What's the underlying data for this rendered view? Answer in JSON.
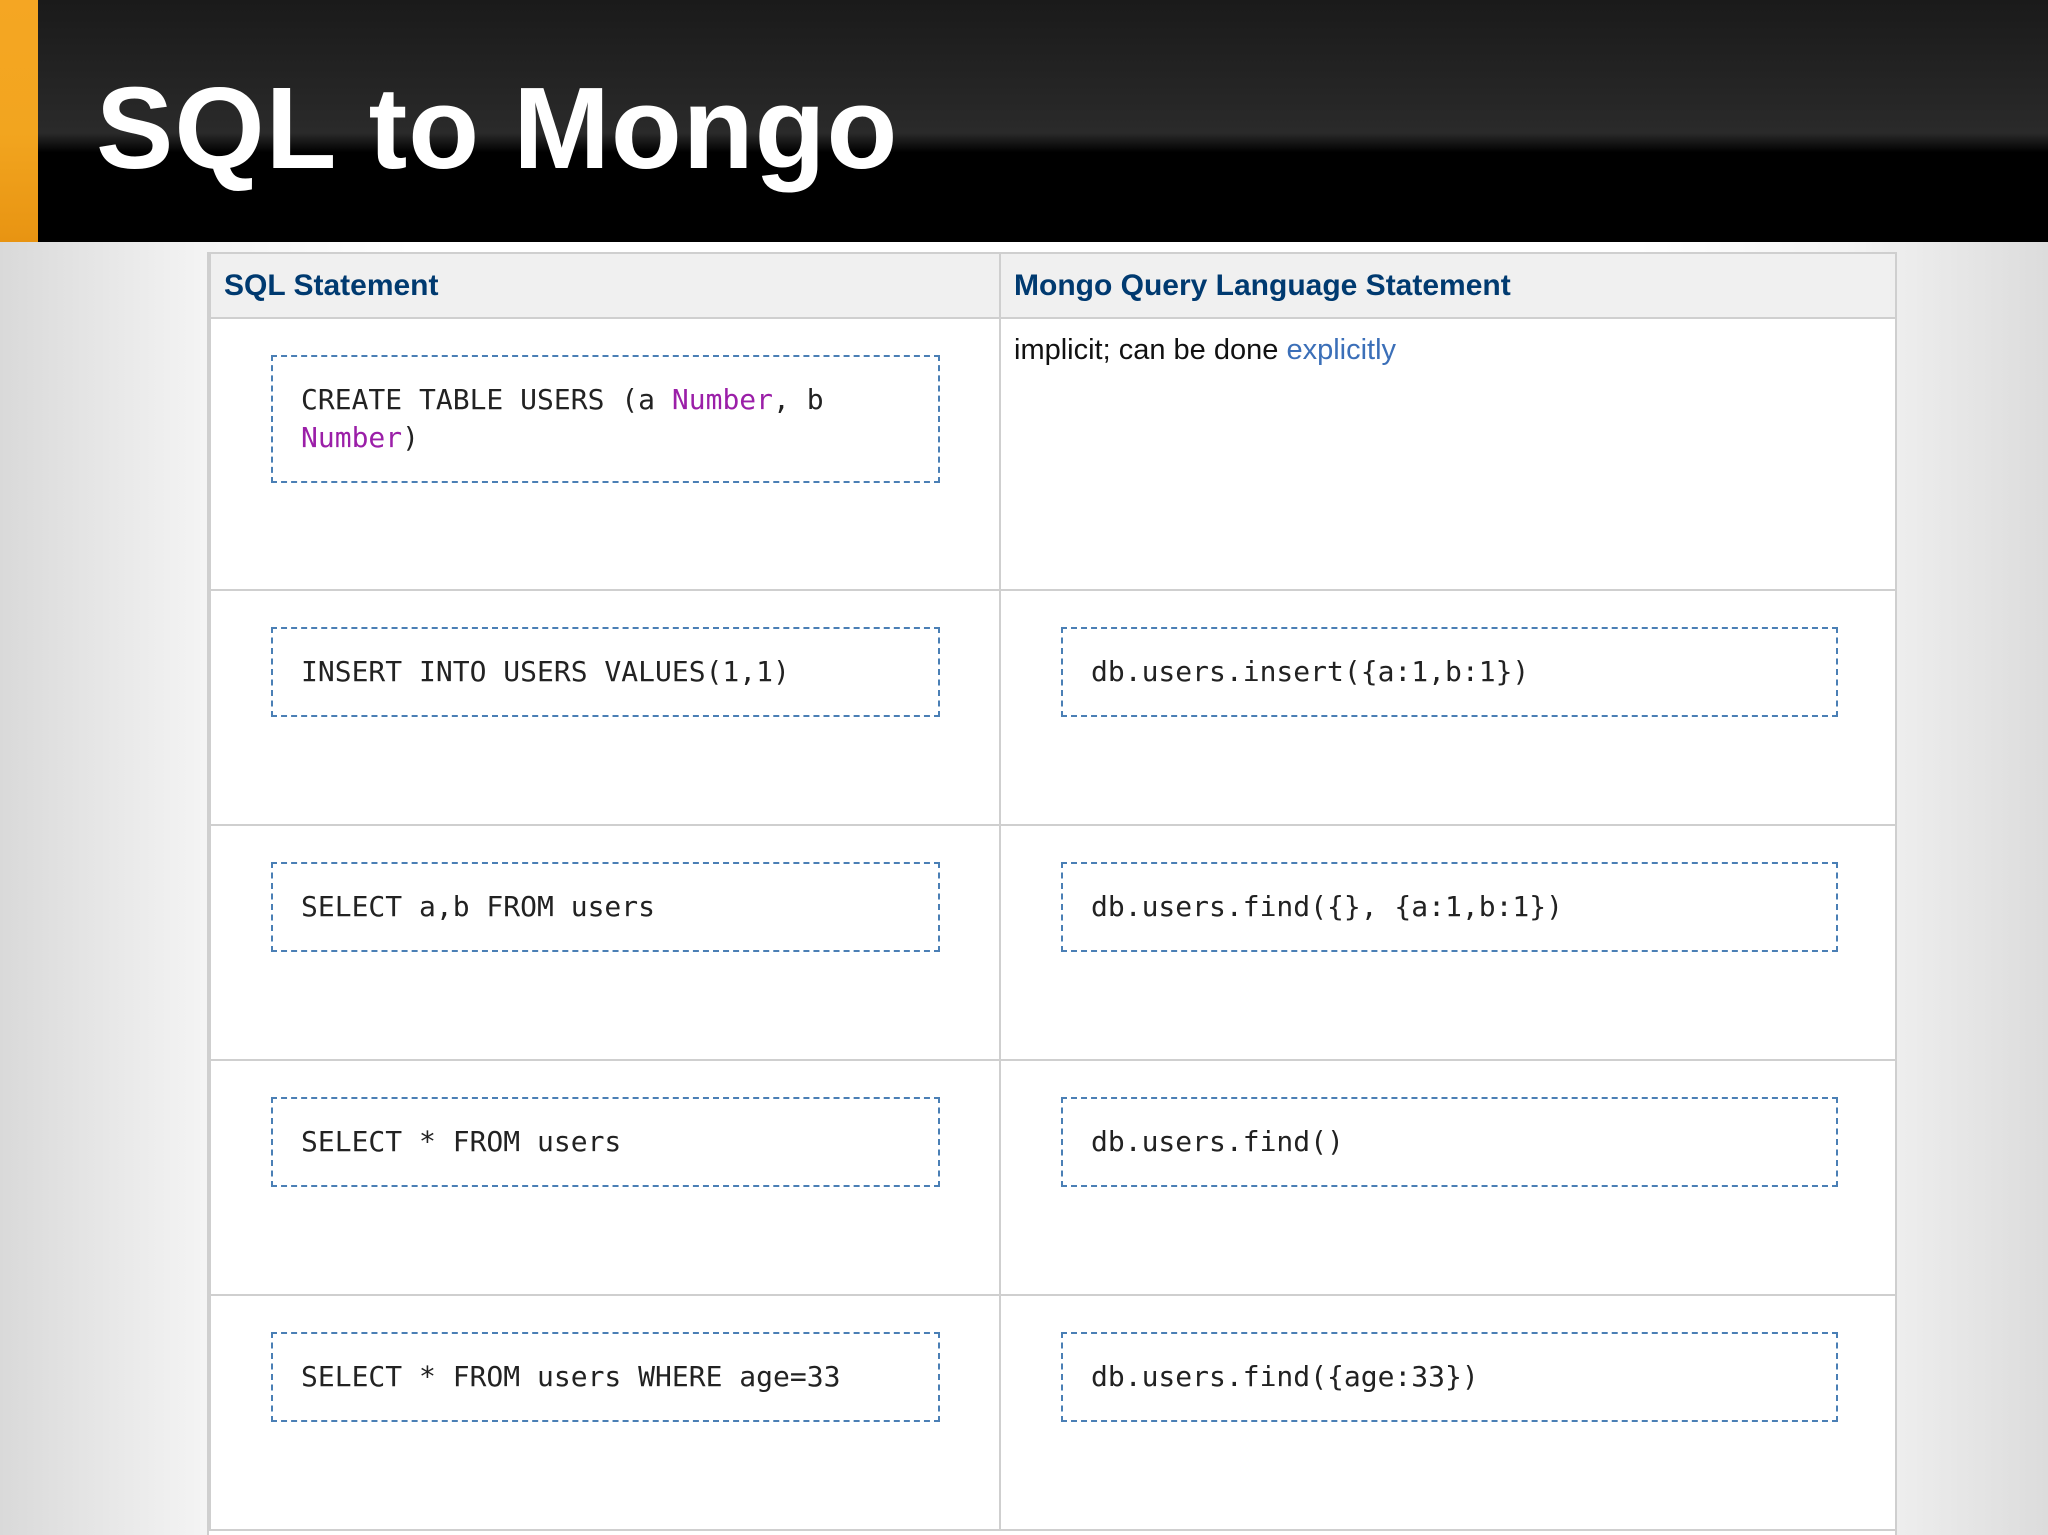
{
  "slide": {
    "title": "SQL to Mongo",
    "accent_color": "#f5a623"
  },
  "table": {
    "headers": [
      "SQL Statement",
      "Mongo Query Language Statement"
    ],
    "rows": [
      {
        "sql": {
          "parts": [
            "CREATE TABLE USERS (a ",
            "Number",
            ", b ",
            "Number",
            ")"
          ]
        },
        "mongo": {
          "text": "implicit; can be done ",
          "link": "explicitly"
        }
      },
      {
        "sql": "INSERT INTO USERS VALUES(1,1)",
        "mongo": "db.users.insert({a:1,b:1})"
      },
      {
        "sql": "SELECT a,b FROM users",
        "mongo": "db.users.find({}, {a:1,b:1})"
      },
      {
        "sql": "SELECT * FROM users",
        "mongo": "db.users.find()"
      },
      {
        "sql": "SELECT * FROM users WHERE age=33",
        "mongo": "db.users.find({age:33})"
      }
    ]
  },
  "colors": {
    "header_text": "#003a70",
    "type_keyword": "#9b1fa8",
    "link": "#3b6fb8",
    "code_border": "#4a7fb5"
  }
}
